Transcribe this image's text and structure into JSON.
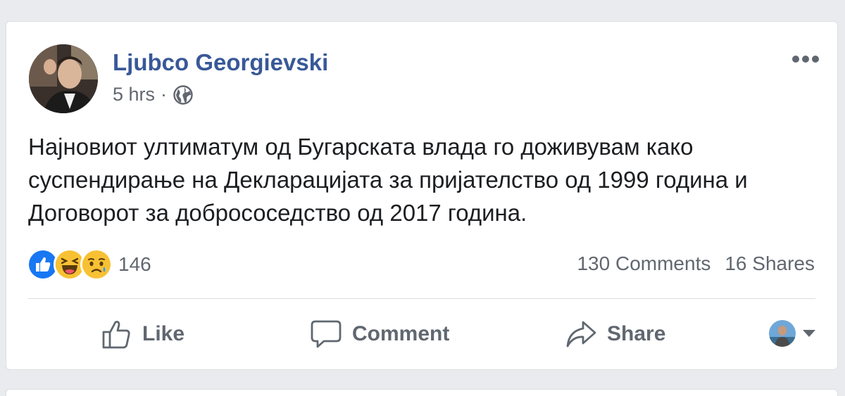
{
  "post": {
    "author": "Ljubco Georgievski",
    "time": "5 hrs",
    "separator": "·",
    "privacy_icon": "globe-icon",
    "text": "Најновиот ултиматум од Бугарската влада го доживувам како суспендирање на Декларацијата за пријателство од 1999 година и Договорот за добрососедство од 2017 година."
  },
  "reactions": {
    "icons": [
      "like-reaction-icon",
      "haha-reaction-icon",
      "sad-reaction-icon"
    ],
    "count": "146"
  },
  "stats": {
    "comments": "130 Comments",
    "shares": "16 Shares"
  },
  "actions": {
    "like": "Like",
    "comment": "Comment",
    "share": "Share"
  },
  "colors": {
    "author_link": "#385898",
    "like_blue": "#1877f2",
    "emoji_yellow": "#f7c133",
    "muted_text": "#616770"
  }
}
